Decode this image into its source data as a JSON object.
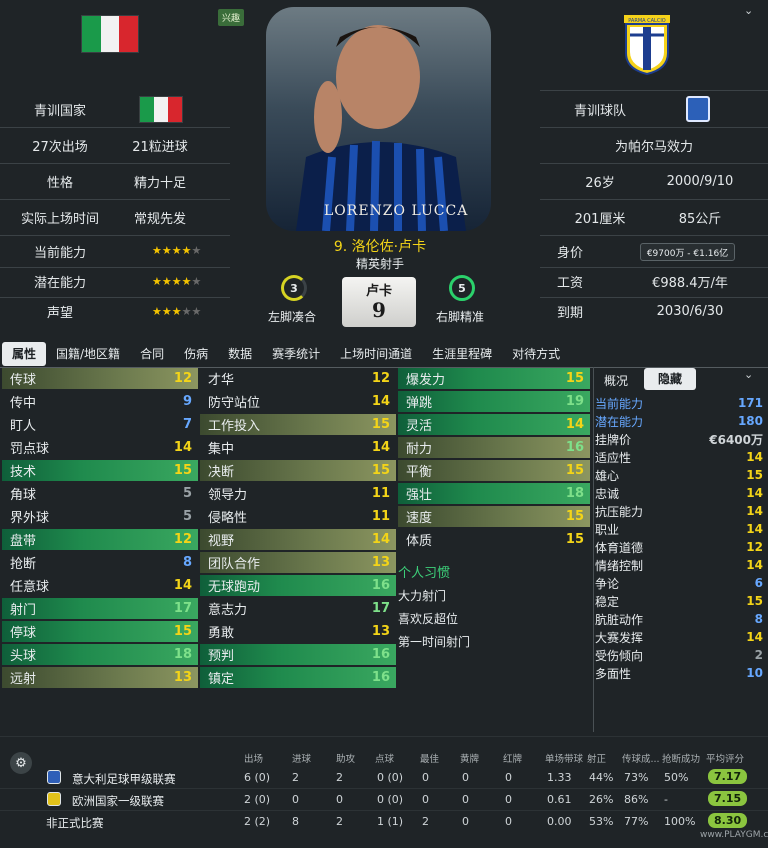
{
  "header": {
    "tag": "兴趣"
  },
  "left_info": [
    {
      "label": "青训国家",
      "value": ""
    },
    {
      "label": "27次出场",
      "value": "21粒进球"
    },
    {
      "label": "性格",
      "value": "精力十足"
    },
    {
      "label": "实际上场时间",
      "value": "常规先发"
    },
    {
      "label": "当前能力",
      "stars": 4.5
    },
    {
      "label": "潜在能力",
      "stars": 4.5
    },
    {
      "label": "声望",
      "stars": 3.5
    }
  ],
  "player": {
    "number_name": "9. 洛伦佐·卢卡",
    "role": "精英射手",
    "shirt_name": "卢卡",
    "shirt_number": "9",
    "photo_text": "LORENZO LUCCA",
    "left_foot": {
      "value": "3",
      "label": "左脚凑合"
    },
    "right_foot": {
      "value": "5",
      "label": "右脚精准"
    }
  },
  "right_info": {
    "youth_team_label": "青训球队",
    "plays_for": "为帕尔马效力",
    "age": "26岁",
    "dob": "2000/9/10",
    "height": "201厘米",
    "weight": "85公斤",
    "value_label": "身价",
    "value": "€9700万 - €1.16亿",
    "wage_label": "工资",
    "wage": "€988.4万/年",
    "expires_label": "到期",
    "expires": "2030/6/30",
    "club_logo_text": "PARMA CALCIO"
  },
  "tabs": [
    "属性",
    "国籍/地区籍",
    "合同",
    "伤病",
    "数据",
    "赛季统计",
    "上场时间通道",
    "生涯里程碑",
    "对待方式"
  ],
  "active_tab": "属性",
  "col1": [
    {
      "name": "传球",
      "value": "12",
      "hl": "o",
      "vc": "vy"
    },
    {
      "name": "传中",
      "value": "9",
      "hl": "",
      "vc": "vb"
    },
    {
      "name": "盯人",
      "value": "7",
      "hl": "",
      "vc": "vb"
    },
    {
      "name": "罚点球",
      "value": "14",
      "hl": "",
      "vc": "vy"
    },
    {
      "name": "技术",
      "value": "15",
      "hl": "g",
      "vc": "vy"
    },
    {
      "name": "角球",
      "value": "5",
      "hl": "",
      "vc": "vgr"
    },
    {
      "name": "界外球",
      "value": "5",
      "hl": "",
      "vc": "vgr"
    },
    {
      "name": "盘带",
      "value": "12",
      "hl": "g",
      "vc": "vy"
    },
    {
      "name": "抢断",
      "value": "8",
      "hl": "",
      "vc": "vb"
    },
    {
      "name": "任意球",
      "value": "14",
      "hl": "",
      "vc": "vy"
    },
    {
      "name": "射门",
      "value": "17",
      "hl": "g",
      "vc": "vg"
    },
    {
      "name": "停球",
      "value": "15",
      "hl": "g",
      "vc": "vy"
    },
    {
      "name": "头球",
      "value": "18",
      "hl": "g",
      "vc": "vg"
    },
    {
      "name": "远射",
      "value": "13",
      "hl": "o",
      "vc": "vy"
    }
  ],
  "col2": [
    {
      "name": "才华",
      "value": "12",
      "hl": "",
      "vc": "vy"
    },
    {
      "name": "防守站位",
      "value": "14",
      "hl": "",
      "vc": "vy"
    },
    {
      "name": "工作投入",
      "value": "15",
      "hl": "o",
      "vc": "vy"
    },
    {
      "name": "集中",
      "value": "14",
      "hl": "",
      "vc": "vy"
    },
    {
      "name": "决断",
      "value": "15",
      "hl": "o",
      "vc": "vy"
    },
    {
      "name": "领导力",
      "value": "11",
      "hl": "",
      "vc": "vy"
    },
    {
      "name": "侵略性",
      "value": "11",
      "hl": "",
      "vc": "vy"
    },
    {
      "name": "视野",
      "value": "14",
      "hl": "o",
      "vc": "vy"
    },
    {
      "name": "团队合作",
      "value": "13",
      "hl": "o",
      "vc": "vy"
    },
    {
      "name": "无球跑动",
      "value": "16",
      "hl": "g",
      "vc": "vg"
    },
    {
      "name": "意志力",
      "value": "17",
      "hl": "",
      "vc": "vg"
    },
    {
      "name": "勇敢",
      "value": "13",
      "hl": "",
      "vc": "vy"
    },
    {
      "name": "预判",
      "value": "16",
      "hl": "g",
      "vc": "vg"
    },
    {
      "name": "镇定",
      "value": "16",
      "hl": "g",
      "vc": "vg"
    }
  ],
  "col3": [
    {
      "name": "爆发力",
      "value": "15",
      "hl": "g",
      "vc": "vy"
    },
    {
      "name": "弹跳",
      "value": "19",
      "hl": "g",
      "vc": "vg"
    },
    {
      "name": "灵活",
      "value": "14",
      "hl": "g",
      "vc": "vy"
    },
    {
      "name": "耐力",
      "value": "16",
      "hl": "o",
      "vc": "vg"
    },
    {
      "name": "平衡",
      "value": "15",
      "hl": "o",
      "vc": "vy"
    },
    {
      "name": "强壮",
      "value": "18",
      "hl": "g",
      "vc": "vg"
    },
    {
      "name": "速度",
      "value": "15",
      "hl": "o",
      "vc": "vy"
    },
    {
      "name": "体质",
      "value": "15",
      "hl": "",
      "vc": "vy"
    }
  ],
  "habits": {
    "title": "个人习惯",
    "items": [
      "大力射门",
      "喜欢反超位",
      "第一时间射门"
    ]
  },
  "hidden_panel": {
    "tabs": [
      "概况",
      "隐藏"
    ],
    "rows": [
      {
        "name": "当前能力",
        "value": "171",
        "nc": "vb",
        "vc": "vb"
      },
      {
        "name": "潜在能力",
        "value": "180",
        "nc": "vb",
        "vc": "vb"
      },
      {
        "name": "挂牌价",
        "value": "€6400万",
        "nc": "vw",
        "vc": "vwb"
      },
      {
        "name": "适应性",
        "value": "14",
        "nc": "vw",
        "vc": "vy"
      },
      {
        "name": "雄心",
        "value": "15",
        "nc": "vw",
        "vc": "vy"
      },
      {
        "name": "忠诚",
        "value": "14",
        "nc": "vw",
        "vc": "vy"
      },
      {
        "name": "抗压能力",
        "value": "14",
        "nc": "vw",
        "vc": "vy"
      },
      {
        "name": "职业",
        "value": "14",
        "nc": "vw",
        "vc": "vy"
      },
      {
        "name": "体育道德",
        "value": "12",
        "nc": "vw",
        "vc": "vy"
      },
      {
        "name": "情绪控制",
        "value": "14",
        "nc": "vw",
        "vc": "vy"
      },
      {
        "name": "争论",
        "value": "6",
        "nc": "vw",
        "vc": "vb"
      },
      {
        "name": "稳定",
        "value": "15",
        "nc": "vw",
        "vc": "vy"
      },
      {
        "name": "肮脏动作",
        "value": "8",
        "nc": "vw",
        "vc": "vb"
      },
      {
        "name": "大赛发挥",
        "value": "14",
        "nc": "vw",
        "vc": "vy"
      },
      {
        "name": "受伤倾向",
        "value": "2",
        "nc": "vw",
        "vc": "vgr"
      },
      {
        "name": "多面性",
        "value": "10",
        "nc": "vw",
        "vc": "vb"
      }
    ]
  },
  "stats": {
    "headers": [
      "出场",
      "进球",
      "助攻",
      "点球",
      "最佳",
      "黄牌",
      "红牌",
      "单场带球",
      "射正",
      "传球成...",
      "抢断成功",
      "平均评分"
    ],
    "rows": [
      {
        "name": "意大利足球甲级联赛",
        "cells": [
          "6 (0)",
          "2",
          "2",
          "0 (0)",
          "0",
          "0",
          "0",
          "1.33",
          "44%",
          "73%",
          "50%"
        ],
        "rating": "7.17"
      },
      {
        "name": "欧洲国家一级联赛",
        "cells": [
          "2 (0)",
          "0",
          "0",
          "0 (0)",
          "0",
          "0",
          "0",
          "0.61",
          "26%",
          "86%",
          "-"
        ],
        "rating": "7.15"
      },
      {
        "name": "非正式比赛",
        "cells": [
          "2 (2)",
          "8",
          "2",
          "1 (1)",
          "2",
          "0",
          "0",
          "0.00",
          "53%",
          "77%",
          "100%"
        ],
        "rating": "8.30"
      }
    ]
  },
  "watermark": "www.PLAYGM.cc"
}
